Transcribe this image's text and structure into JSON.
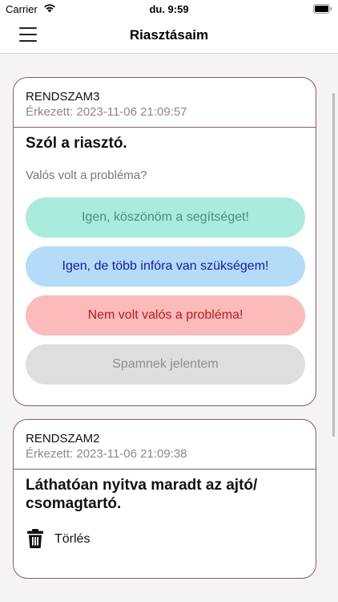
{
  "status_bar": {
    "carrier": "Carrier",
    "time": "du. 9:59"
  },
  "nav": {
    "title": "Riasztásaim"
  },
  "alerts": [
    {
      "plate": "RENDSZAM3",
      "arrived": "Érkezett: 2023-11-06 21:09:57",
      "message": "Szól a riasztó.",
      "question": "Valós volt a probléma?",
      "buttons": {
        "yes": "Igen, köszönöm a segítséget!",
        "info": "Igen, de több infóra van szükségem!",
        "false_alarm": "Nem volt valós a probléma!",
        "spam": "Spamnek jelentem"
      }
    },
    {
      "plate": "RENDSZAM2",
      "arrived": "Érkezett: 2023-11-06 21:09:38",
      "message": "Láthatóan nyitva maradt az ajtó/ csomagtartó.",
      "delete_label": "Törlés"
    }
  ],
  "colors": {
    "card_border": "#8a5a6a",
    "yes_bg": "#a9ecdd",
    "info_bg": "#b4dcf8",
    "false_bg": "#fbbbbb",
    "spam_bg": "#dedede"
  }
}
